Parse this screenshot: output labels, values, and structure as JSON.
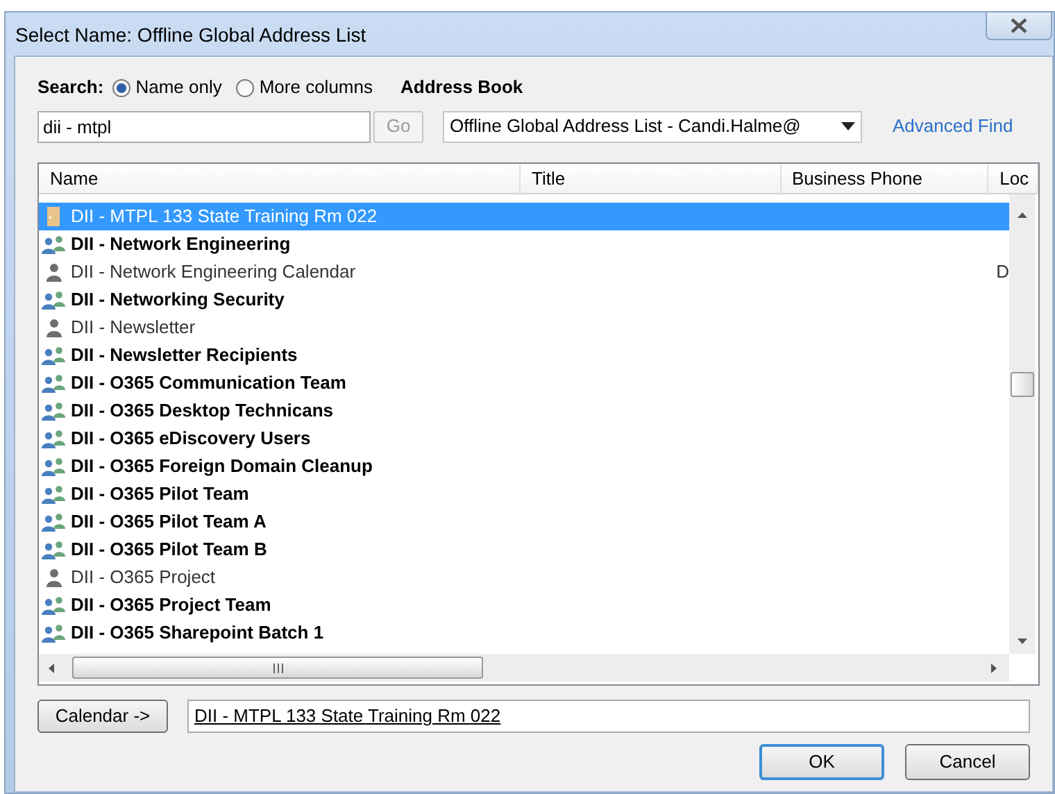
{
  "window": {
    "title": "Select Name: Offline Global Address List"
  },
  "search": {
    "label": "Search:",
    "options": [
      {
        "label": "Name only",
        "selected": true
      },
      {
        "label": "More columns",
        "selected": false
      }
    ],
    "value": "dii - mtpl",
    "go_button": "Go"
  },
  "address_book": {
    "label": "Address Book",
    "value": "Offline Global Address List - Candi.Halme@",
    "advanced_find": "Advanced Find"
  },
  "table": {
    "columns": [
      "Name",
      "Title",
      "Business Phone",
      "Loc"
    ],
    "rows": [
      {
        "kind": "room",
        "name": "DII - MTPL 133 State Training Rm 022",
        "selected": true
      },
      {
        "kind": "group",
        "name": "DII - Network Engineering",
        "selected": false
      },
      {
        "kind": "user",
        "name": "DII - Network Engineering Calendar",
        "location": "D",
        "selected": false
      },
      {
        "kind": "group",
        "name": "DII - Networking Security",
        "selected": false
      },
      {
        "kind": "user",
        "name": "DII - Newsletter",
        "selected": false
      },
      {
        "kind": "group",
        "name": "DII - Newsletter Recipients",
        "selected": false
      },
      {
        "kind": "group",
        "name": "DII - O365 Communication Team",
        "selected": false
      },
      {
        "kind": "group",
        "name": "DII - O365 Desktop Technicans",
        "selected": false
      },
      {
        "kind": "group",
        "name": "DII - O365 eDiscovery Users",
        "selected": false
      },
      {
        "kind": "group",
        "name": "DII - O365 Foreign Domain Cleanup",
        "selected": false
      },
      {
        "kind": "group",
        "name": "DII - O365 Pilot Team",
        "selected": false
      },
      {
        "kind": "group",
        "name": "DII - O365 Pilot Team A",
        "selected": false
      },
      {
        "kind": "group",
        "name": "DII - O365 Pilot Team B",
        "selected": false
      },
      {
        "kind": "user",
        "name": "DII - O365 Project",
        "selected": false
      },
      {
        "kind": "group",
        "name": "DII - O365 Project Team",
        "selected": false
      },
      {
        "kind": "group",
        "name": "DII - O365 Sharepoint Batch 1",
        "selected": false
      }
    ]
  },
  "recipient": {
    "button": "Calendar ->",
    "value": "DII - MTPL 133 State Training Rm 022"
  },
  "buttons": [
    {
      "label": "OK",
      "default": true
    },
    {
      "label": "Cancel",
      "default": false
    }
  ]
}
